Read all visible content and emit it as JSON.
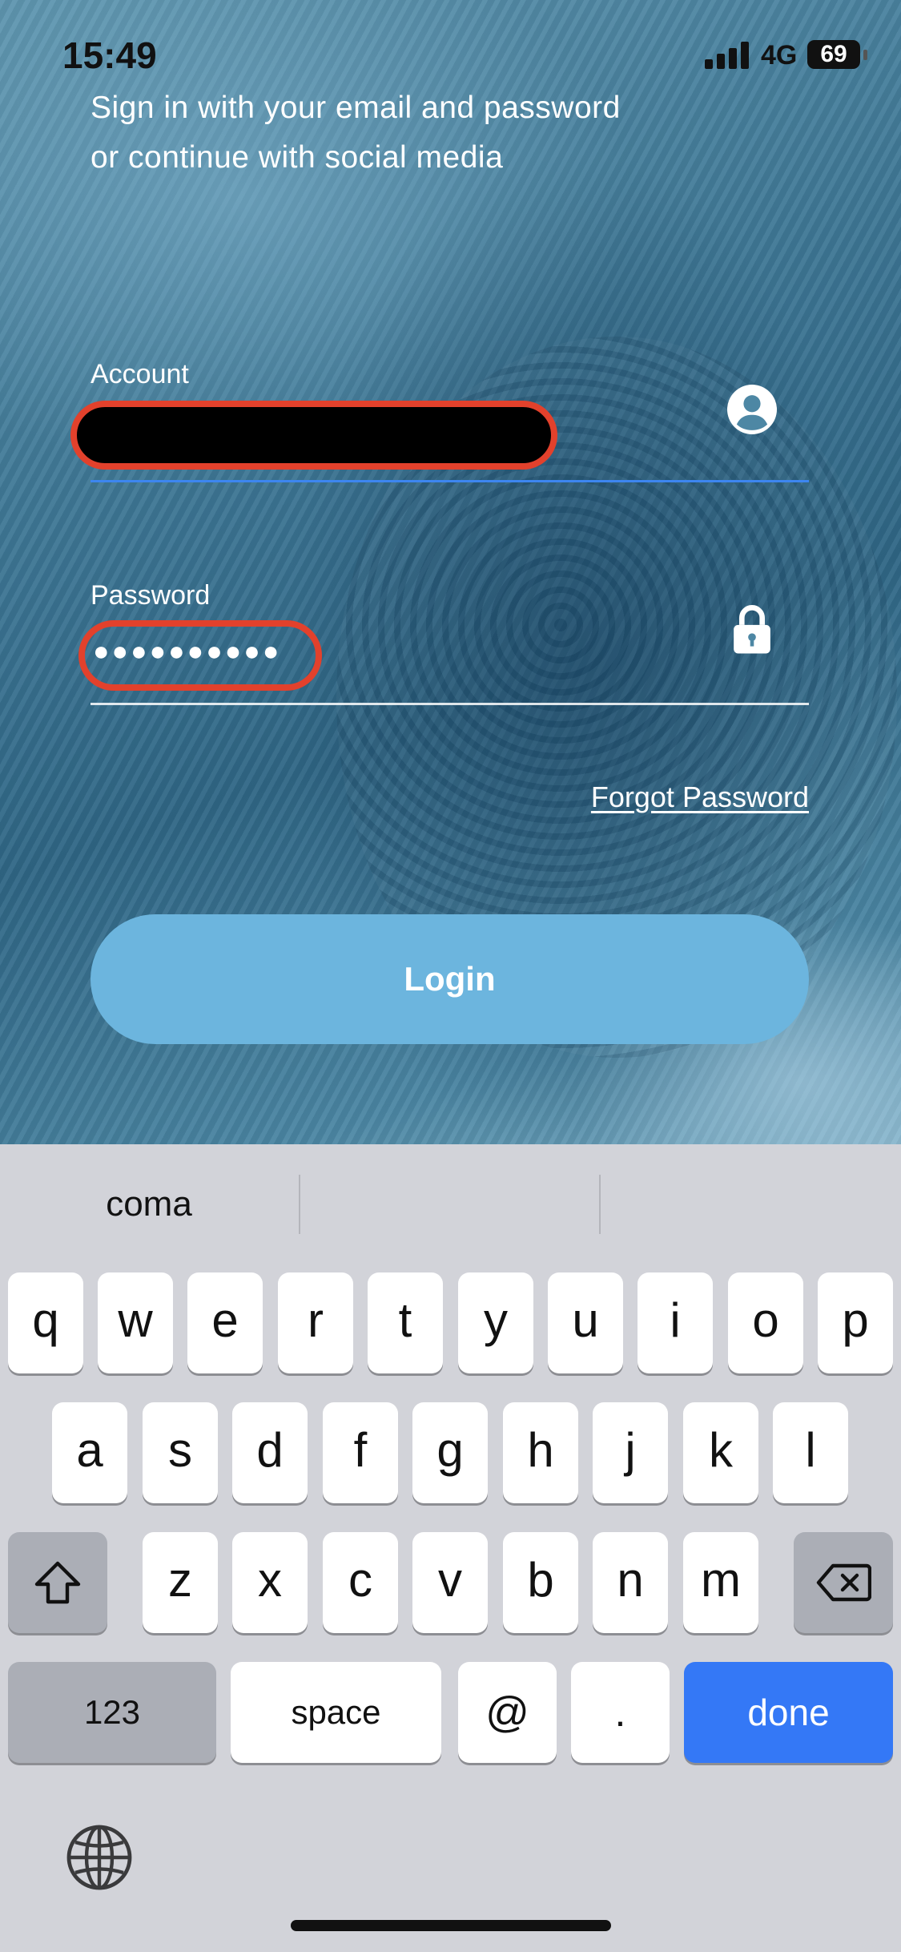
{
  "status_bar": {
    "time": "15:49",
    "network": "4G",
    "battery": "69"
  },
  "login": {
    "subtitle_line1": "Sign in with your email and password",
    "subtitle_line2": "or continue with social media",
    "account_label": "Account",
    "account_value": "",
    "password_label": "Password",
    "password_value": "●●●●●●●●●●",
    "forgot_password": "Forgot Password",
    "login_button": "Login",
    "colors": {
      "button": "#6cb5de",
      "active_underline": "#3d86f0",
      "highlight": "#e2412c"
    }
  },
  "keyboard": {
    "suggestions": [
      "coma",
      "",
      ""
    ],
    "row1": [
      "q",
      "w",
      "e",
      "r",
      "t",
      "y",
      "u",
      "i",
      "o",
      "p"
    ],
    "row2": [
      "a",
      "s",
      "d",
      "f",
      "g",
      "h",
      "j",
      "k",
      "l"
    ],
    "row3": [
      "z",
      "x",
      "c",
      "v",
      "b",
      "n",
      "m"
    ],
    "numbers_key": "123",
    "space_key": "space",
    "at_key": "@",
    "dot_key": ".",
    "done_key": "done",
    "icons": [
      "shift-icon",
      "backspace-icon",
      "globe-icon"
    ]
  }
}
